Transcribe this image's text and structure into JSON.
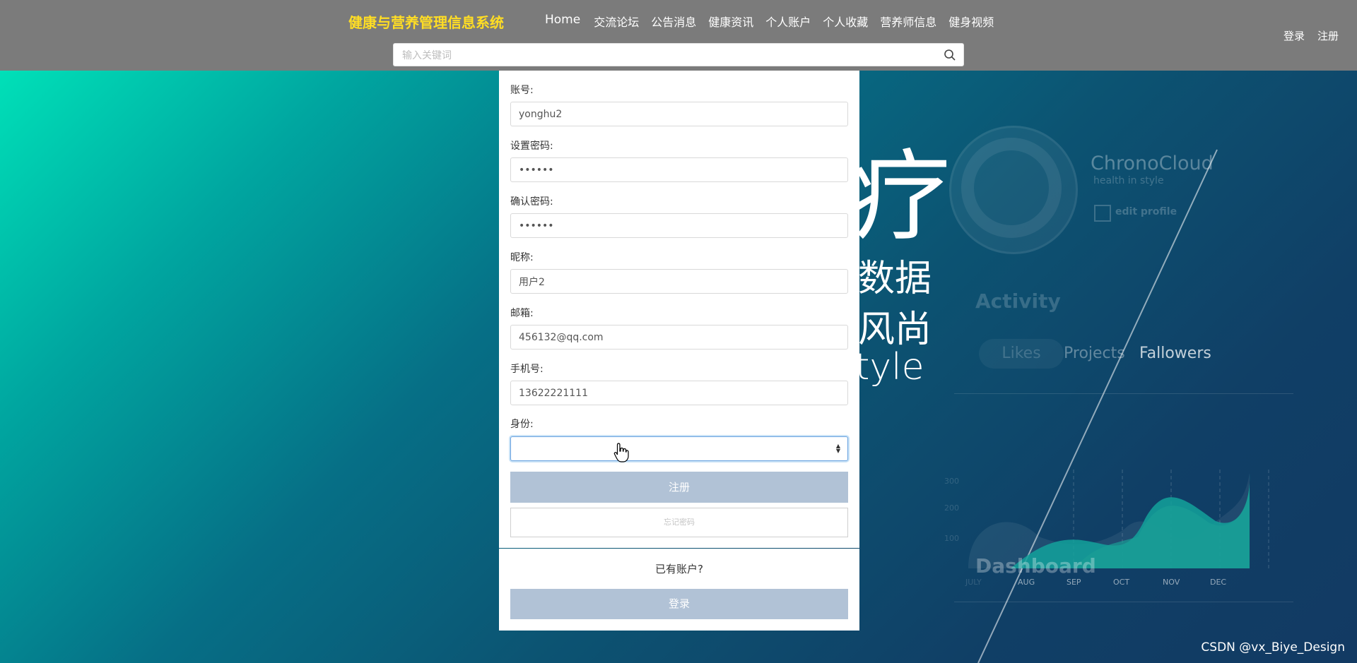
{
  "header": {
    "brand": "健康与营养管理信息系统",
    "nav": [
      "Home",
      "交流论坛",
      "公告消息",
      "健康资讯",
      "个人账户",
      "个人收藏",
      "营养师信息",
      "健身视频"
    ],
    "login": "登录",
    "register": "注册",
    "search_placeholder": "输入关键词"
  },
  "background": {
    "big_text": "疗",
    "line1": "数据",
    "line2": "风尚",
    "line3": "tyle",
    "cc_name": "ChronoCloud",
    "cc_sub": "health in style",
    "cc_edit": "edit profile",
    "activity": "Activity",
    "tabs": [
      "Likes",
      "Projects",
      "Fallowers"
    ],
    "chart_y": [
      "300",
      "200",
      "100"
    ],
    "chart_x": [
      "JULY",
      "AUG",
      "SEP",
      "OCT",
      "NOV",
      "DEC"
    ],
    "dashboard": "Dashboard"
  },
  "form": {
    "account_label": "账号:",
    "account_value": "yonghu2",
    "password_label": "设置密码:",
    "password_value": "123456",
    "confirm_label": "确认密码:",
    "confirm_value": "123456",
    "nickname_label": "昵称:",
    "nickname_value": "用户2",
    "email_label": "邮箱:",
    "email_value": "456132@qq.com",
    "phone_label": "手机号:",
    "phone_value": "13622221111",
    "role_label": "身份:",
    "role_value": "",
    "register_button": "注册",
    "forgot_button": "忘记密码",
    "has_account": "已有账户?",
    "login_button": "登录"
  },
  "watermark": "CSDN @vx_Biye_Design",
  "colors": {
    "header_bg": "#7b7b7b",
    "brand": "#ffdd24",
    "button_bg": "#b1c2d6"
  }
}
